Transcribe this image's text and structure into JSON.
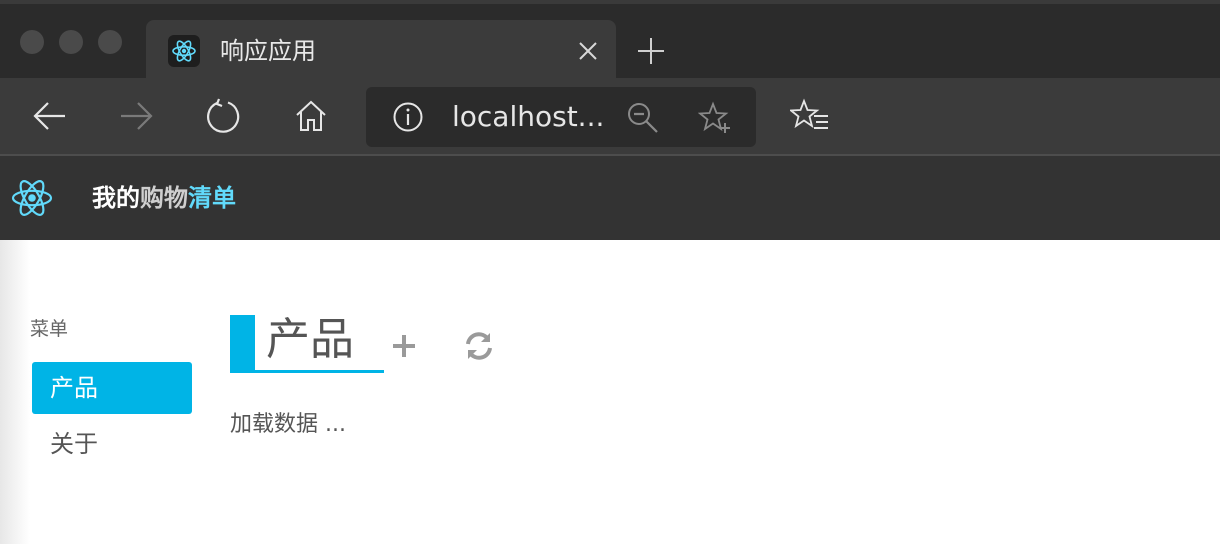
{
  "browser": {
    "tab_title": "响应应用",
    "address_text": "localhost..."
  },
  "app": {
    "brand_part1": "我的",
    "brand_part2": "购物",
    "brand_part3": "清单"
  },
  "sidebar": {
    "title": "菜单",
    "items": [
      {
        "label": "产品",
        "active": true
      },
      {
        "label": "关于",
        "active": false
      }
    ]
  },
  "main": {
    "title": "产品",
    "loading_text": "加载数据 ..."
  },
  "colors": {
    "accent": "#00b4e6",
    "react": "#61dafb",
    "header_bg": "#333333",
    "chrome_bg": "#2b2b2b"
  },
  "icons": {
    "tab_favicon": "react-icon",
    "close": "close-icon",
    "new_tab": "plus-icon",
    "back": "arrow-left-icon",
    "forward": "arrow-right-icon",
    "refresh": "refresh-icon",
    "home": "home-icon",
    "info": "info-icon",
    "zoom": "zoom-out-icon",
    "favorite": "star-add-icon",
    "favorites": "favorites-icon",
    "add": "plus-icon",
    "reload_list": "sync-icon"
  }
}
